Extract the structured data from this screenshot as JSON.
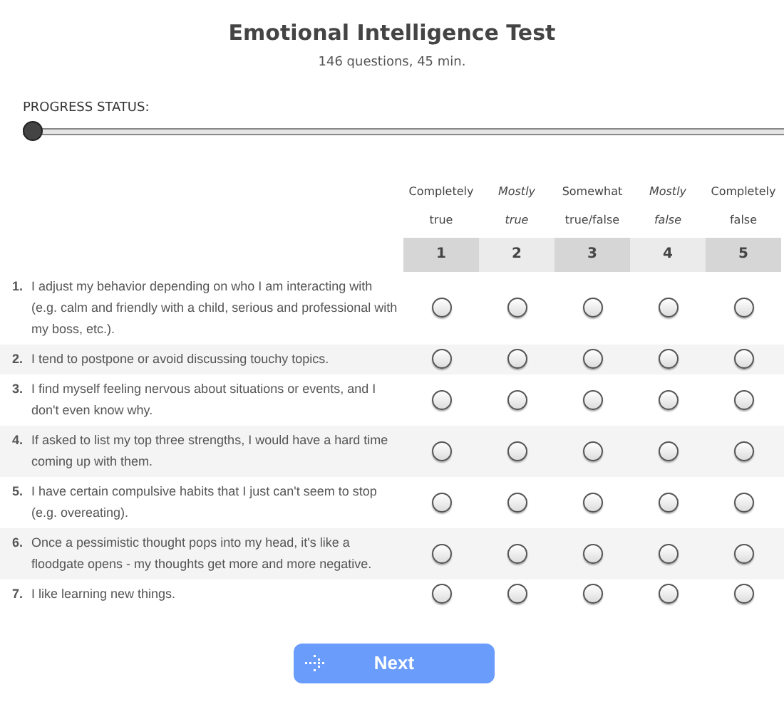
{
  "title": "Emotional Intelligence Test",
  "subtitle": "146 questions, 45 min.",
  "progress": {
    "label": "PROGRESS STATUS:",
    "level": 0
  },
  "scale": [
    {
      "label_top": "Completely",
      "label_bottom": "true",
      "number": "1"
    },
    {
      "label_top": "Mostly",
      "label_bottom": "true",
      "number": "2"
    },
    {
      "label_top": "Somewhat",
      "label_bottom": "true/false",
      "number": "3"
    },
    {
      "label_top": "Mostly",
      "label_bottom": "false",
      "number": "4"
    },
    {
      "label_top": "Completely",
      "label_bottom": "false",
      "number": "5"
    }
  ],
  "questions": [
    {
      "number": "1.",
      "text": "I adjust my behavior depending on who I am interacting with (e.g. calm and friendly with a child, serious and professional with my boss, etc.).",
      "answers": [
        false,
        false,
        false,
        false,
        false
      ]
    },
    {
      "number": "2.",
      "text": "I tend to postpone or avoid discussing touchy topics.",
      "answers": [
        false,
        false,
        false,
        false,
        false
      ]
    },
    {
      "number": "3.",
      "text": "I find myself feeling nervous about situations or events, and I don't even know why.",
      "answers": [
        false,
        false,
        false,
        false,
        false
      ]
    },
    {
      "number": "4.",
      "text": "If asked to list my top three strengths, I would have a hard time coming up with them.",
      "answers": [
        false,
        false,
        false,
        false,
        false
      ]
    },
    {
      "number": "5.",
      "text": "I have certain compulsive habits that I just can't seem to stop (e.g. overeating).",
      "answers": [
        false,
        false,
        false,
        false,
        false
      ]
    },
    {
      "number": "6.",
      "text": "Once a pessimistic thought pops into my head, it's like a floodgate opens - my thoughts get more and more negative.",
      "answers": [
        false,
        false,
        false,
        false,
        false
      ]
    },
    {
      "number": "7.",
      "text": "I like learning new things.",
      "answers": [
        false,
        false,
        false,
        false,
        false
      ]
    }
  ],
  "next_button": "Next"
}
